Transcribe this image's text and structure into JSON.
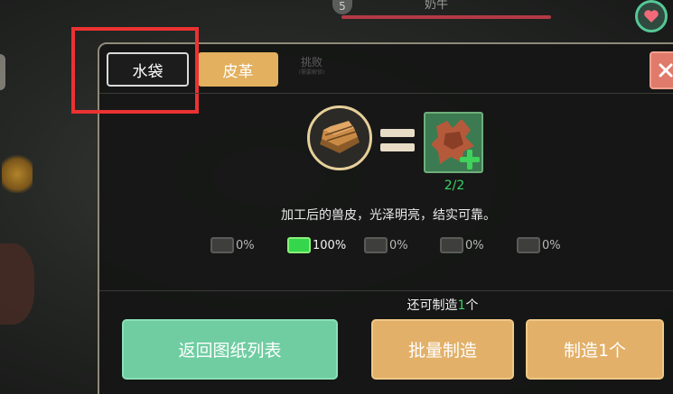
{
  "hud": {
    "badge_number": "5",
    "target_name": "奶牛",
    "health_bar_fill": 1.0
  },
  "tabs": [
    {
      "label": "水袋",
      "state": "selected"
    },
    {
      "label": "皮革",
      "state": "normal"
    },
    {
      "label": "挑败",
      "sublabel": "(需要解锁)",
      "state": "disabled"
    }
  ],
  "recipe": {
    "ingredient_icon": "hide-bundle-icon",
    "result_icon": "leather-hide-icon",
    "count": "2/2",
    "description": "加工后的兽皮，光泽明亮，结实可靠。"
  },
  "quality_options": [
    {
      "label": "0%",
      "selected": false
    },
    {
      "label": "100%",
      "selected": true
    },
    {
      "label": "0%",
      "selected": false
    },
    {
      "label": "0%",
      "selected": false
    },
    {
      "label": "0%",
      "selected": false
    }
  ],
  "craft_info": {
    "prefix": "还可制造",
    "number": "1",
    "suffix": "个"
  },
  "buttons": {
    "back": "返回图纸列表",
    "batch": "批量制造",
    "one": "制造1个"
  },
  "colors": {
    "accent_gold": "#e2b05e",
    "accent_green": "#6fcda1",
    "highlight_red": "#ec3232",
    "close_red": "#e07a6a"
  }
}
